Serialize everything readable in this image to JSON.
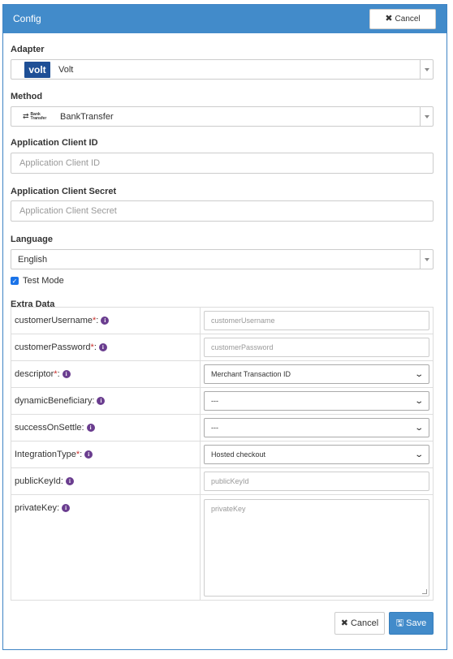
{
  "header": {
    "title": "Config",
    "cancel_label": "Cancel"
  },
  "adapter": {
    "label": "Adapter",
    "value": "Volt",
    "logo_text": "volt"
  },
  "method": {
    "label": "Method",
    "value": "BankTransfer",
    "logo_line1": "Bank",
    "logo_line2": "Transfer"
  },
  "client_id": {
    "label": "Application Client ID",
    "placeholder": "Application Client ID"
  },
  "client_secret": {
    "label": "Application Client Secret",
    "placeholder": "Application Client Secret"
  },
  "language": {
    "label": "Language",
    "value": "English"
  },
  "test_mode": {
    "label": "Test Mode",
    "checked": true
  },
  "extra": {
    "label": "Extra Data",
    "rows": [
      {
        "key": "customerUsername",
        "required": "*",
        "suffix": ":",
        "type": "input",
        "placeholder": "customerUsername"
      },
      {
        "key": "customerPassword",
        "required": "*",
        "suffix": ":",
        "type": "input",
        "placeholder": "customerPassword"
      },
      {
        "key": "descriptor",
        "required": "*",
        "suffix": ":",
        "type": "select",
        "value": "Merchant Transaction ID"
      },
      {
        "key": "dynamicBeneficiary",
        "required": "",
        "suffix": ":",
        "type": "select",
        "value": "---"
      },
      {
        "key": "successOnSettle",
        "required": "",
        "suffix": ":",
        "type": "select",
        "value": "---"
      },
      {
        "key": "IntegrationType",
        "required": "*",
        "suffix": ":",
        "type": "select",
        "value": "Hosted checkout"
      },
      {
        "key": "publicKeyId",
        "required": "",
        "suffix": ":",
        "type": "input",
        "placeholder": "publicKeyId"
      },
      {
        "key": "privateKey",
        "required": "",
        "suffix": ":",
        "type": "textarea",
        "placeholder": "privateKey"
      }
    ]
  },
  "footer": {
    "cancel_label": "Cancel",
    "save_label": "Save"
  },
  "colors": {
    "header_bg": "#428bca",
    "primary": "#428bca",
    "required": "#c9302c",
    "info_icon": "#6a3d8f",
    "volt_logo": "#1e4f96"
  },
  "icons": {
    "cancel": "close-icon",
    "save": "floppy-disk-icon",
    "info": "info-circle-icon",
    "select": "chevron-down-icon"
  }
}
